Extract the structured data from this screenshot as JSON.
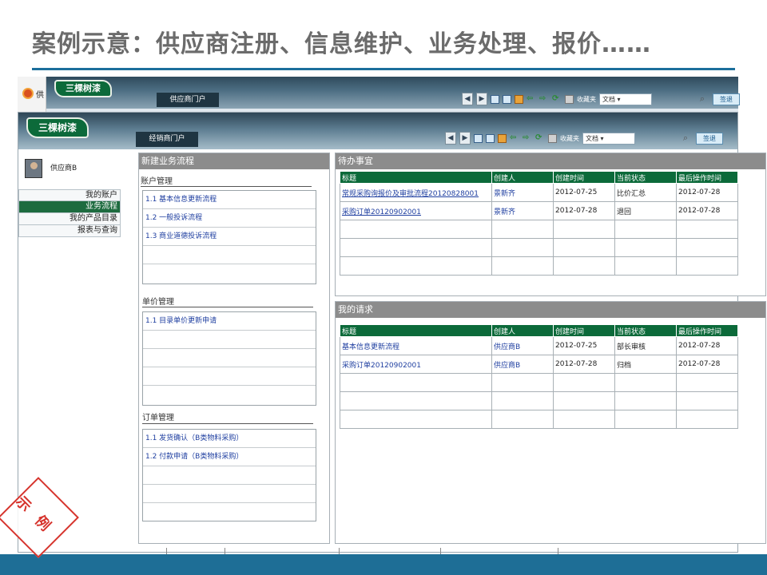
{
  "slide": {
    "title": "案例示意：供应商注册、信息维护、业务处理、报价……",
    "stamp_text": "示例"
  },
  "rear_window": {
    "browser_tab_text": "供",
    "logo_text": "三棵树漆",
    "tab_label": "供应商门户",
    "toolbar": {
      "favorites": "收藏夹",
      "doc_select": "文档",
      "signout": "签退"
    }
  },
  "front_window": {
    "logo_text": "三棵树漆",
    "tab_label": "经销商门户",
    "toolbar": {
      "favorites": "收藏夹",
      "doc_select": "文档",
      "signout": "签退"
    }
  },
  "user": {
    "name": "供应商B"
  },
  "left_menu": [
    {
      "label": "我的账户",
      "active": false
    },
    {
      "label": "业务流程",
      "active": true
    },
    {
      "label": "我的产品目录",
      "active": false
    },
    {
      "label": "报表与查询",
      "active": false
    }
  ],
  "new_process": {
    "header": "新建业务流程",
    "sections": [
      {
        "title": "账户管理",
        "links": [
          "1.1 基本信息更新流程",
          "1.2 一般投诉流程",
          "1.3 商业道德投诉流程"
        ]
      },
      {
        "title": "单价管理",
        "links": [
          "1.1 目录单价更新申请"
        ]
      },
      {
        "title": "订单管理",
        "links": [
          "1.1 发货确认（B类物料采购）",
          "1.2 付款申请（B类物料采购）"
        ]
      }
    ]
  },
  "todo": {
    "header": "待办事宜",
    "columns": [
      "标题",
      "创建人",
      "创建时间",
      "当前状态",
      "最后操作时间"
    ],
    "rows": [
      {
        "title": "常规采购询报价及审批流程20120828001",
        "creator": "景新齐",
        "created": "2012-07-25",
        "status": "比价汇总",
        "last": "2012-07-28"
      },
      {
        "title": "采购订单20120902001",
        "creator": "景新齐",
        "created": "2012-07-28",
        "status": "退回",
        "last": "2012-07-28"
      }
    ]
  },
  "my_requests": {
    "header": "我的请求",
    "columns": [
      "标题",
      "创建人",
      "创建时间",
      "当前状态",
      "最后操作时间"
    ],
    "rows": [
      {
        "title": "基本信息更新流程",
        "creator": "供应商B",
        "created": "2012-07-25",
        "status": "部长审核",
        "last": "2012-07-28"
      },
      {
        "title": "采购订单20120902001",
        "creator": "供应商B",
        "created": "2012-07-28",
        "status": "归档",
        "last": "2012-07-28"
      }
    ]
  }
}
